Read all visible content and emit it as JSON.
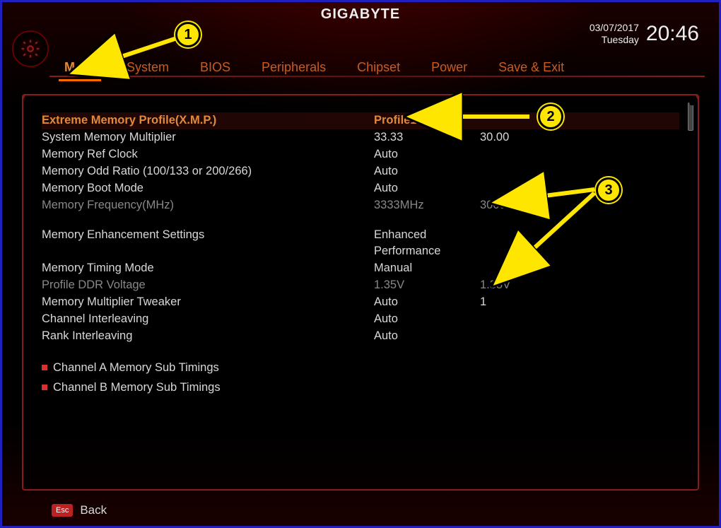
{
  "brand": "GIGABYTE",
  "datetime": {
    "date": "03/07/2017",
    "day": "Tuesday",
    "time": "20:46"
  },
  "tabs": {
    "items": [
      {
        "label": "M.I.T.",
        "active": true
      },
      {
        "label": "System",
        "active": false
      },
      {
        "label": "BIOS",
        "active": false
      },
      {
        "label": "Peripherals",
        "active": false
      },
      {
        "label": "Chipset",
        "active": false
      },
      {
        "label": "Power",
        "active": false
      },
      {
        "label": "Save & Exit",
        "active": false
      }
    ]
  },
  "settings": [
    {
      "label": "Extreme Memory Profile(X.M.P.)",
      "value": "Profile1",
      "value2": "",
      "style": "highlight"
    },
    {
      "label": "System Memory Multiplier",
      "value": "33.33",
      "value2": "30.00",
      "style": ""
    },
    {
      "label": "Memory Ref Clock",
      "value": "Auto",
      "value2": "",
      "style": ""
    },
    {
      "label": "Memory Odd Ratio (100/133 or 200/266)",
      "value": "Auto",
      "value2": "",
      "style": ""
    },
    {
      "label": "Memory Boot Mode",
      "value": "Auto",
      "value2": "",
      "style": ""
    },
    {
      "label": "Memory Frequency(MHz)",
      "value": "3333MHz",
      "value2": "3000MHz",
      "style": "dim"
    }
  ],
  "settings2": [
    {
      "label": "Memory Enhancement Settings",
      "value": "Enhanced Performance",
      "value2": "",
      "style": ""
    },
    {
      "label": "Memory Timing Mode",
      "value": "Manual",
      "value2": "",
      "style": ""
    },
    {
      "label": "Profile DDR Voltage",
      "value": "1.35V",
      "value2": "1.35V",
      "style": "dim"
    },
    {
      "label": "Memory Multiplier Tweaker",
      "value": "Auto",
      "value2": "1",
      "style": ""
    },
    {
      "label": "Channel Interleaving",
      "value": "Auto",
      "value2": "",
      "style": ""
    },
    {
      "label": "Rank Interleaving",
      "value": "Auto",
      "value2": "",
      "style": ""
    }
  ],
  "subtimings": [
    "Channel A Memory Sub Timings",
    "Channel B Memory Sub Timings"
  ],
  "footer": {
    "esc": "Esc",
    "back": "Back"
  },
  "annotations": {
    "c1": "1",
    "c2": "2",
    "c3": "3"
  }
}
